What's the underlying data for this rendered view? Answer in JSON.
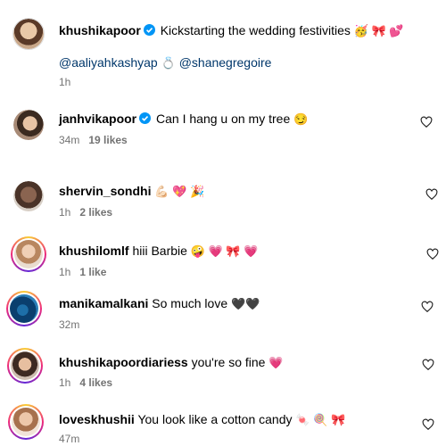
{
  "comments": [
    {
      "user": "khushikapoor",
      "verified": true,
      "text": "Kickstarting the wedding festivities",
      "emoji": "🥳 🎀 💕",
      "mention1": "@aaliyahkashyap",
      "ring_emoji": "💍",
      "mention2": "@shanegregoire",
      "time": "1h",
      "likes": ""
    },
    {
      "user": "janhvikapoor",
      "verified": true,
      "text": "Can I hang u on my tree",
      "emoji": "😏",
      "time": "34m",
      "likes": "19 likes"
    },
    {
      "user": "shervin_sondhi",
      "verified": false,
      "text": "",
      "emoji": "💪🏻 💖 🎉",
      "time": "1h",
      "likes": "2 likes"
    },
    {
      "user": "khushilomlf",
      "verified": false,
      "text": "hiii Barbie",
      "emoji": "🤪 💗 🎀 💗",
      "time": "1h",
      "likes": "1 like"
    },
    {
      "user": "manikamalkani",
      "verified": false,
      "text": "So much love",
      "emoji": "🖤🖤",
      "time": "32m",
      "likes": ""
    },
    {
      "user": "khushikapoordiariess",
      "verified": false,
      "text": "you're so fine",
      "emoji": "💗",
      "time": "1h",
      "likes": "4 likes"
    },
    {
      "user": "loveskhushii",
      "verified": false,
      "text": "You look like a cotton candy",
      "emoji": "🍬 🍭 🎀",
      "time": "47m",
      "likes": ""
    }
  ]
}
